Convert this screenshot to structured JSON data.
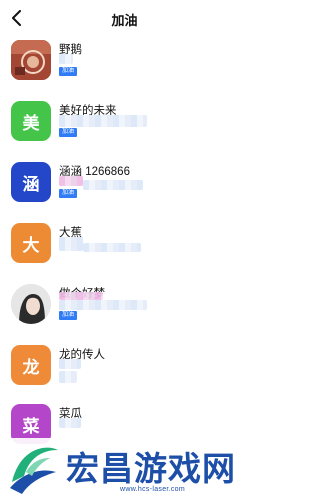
{
  "header": {
    "title": "加油",
    "back_icon": "chevron-left-icon"
  },
  "members": [
    {
      "name": "野鹅",
      "avatar_type": "photo",
      "avatar_char": "",
      "avatar_color": "#b0523f",
      "tag": "加油"
    },
    {
      "name": "美好的未来",
      "avatar_type": "letter",
      "avatar_char": "美",
      "avatar_color": "#45c44a",
      "tag": "加油"
    },
    {
      "name": "涵涵 1266866",
      "avatar_type": "letter",
      "avatar_char": "涵",
      "avatar_color": "#2447c9",
      "tag": "加油"
    },
    {
      "name": "大蕉",
      "avatar_type": "letter",
      "avatar_char": "大",
      "avatar_color": "#ec8b33",
      "tag": ""
    },
    {
      "name": "做个好梦",
      "avatar_type": "photo",
      "avatar_char": "",
      "avatar_color": "#d9d9d9",
      "tag": "加油"
    },
    {
      "name": "龙的传人",
      "avatar_type": "letter",
      "avatar_char": "龙",
      "avatar_color": "#ee8a38",
      "tag": ""
    },
    {
      "name": "菜瓜",
      "avatar_type": "letter",
      "avatar_char": "菜",
      "avatar_color": "#b447c9",
      "tag": ""
    }
  ],
  "watermark": {
    "text": "宏昌游戏网",
    "url": "www.hcs-laser.com",
    "color": "#1d4fa8"
  }
}
